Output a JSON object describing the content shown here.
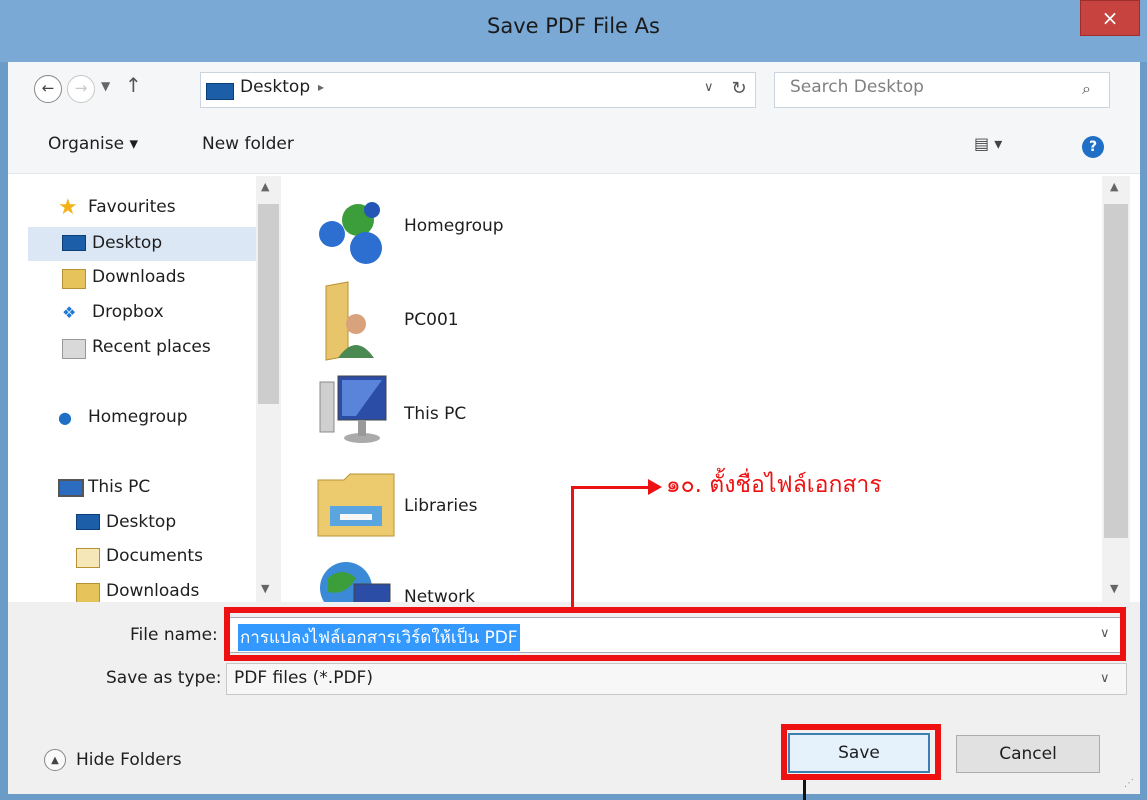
{
  "window": {
    "title": "Save PDF File As",
    "close_glyph": "×"
  },
  "address": {
    "path": "Desktop",
    "separator": "▸",
    "search_placeholder": "Search Desktop"
  },
  "toolbar": {
    "organise": "Organise ▾",
    "new_folder": "New folder",
    "view_glyph": "▤ ▾",
    "help_glyph": "?"
  },
  "nav": {
    "items": [
      {
        "label": "Favourites",
        "icon": "star-icon"
      },
      {
        "label": "Desktop",
        "icon": "desktop-icon",
        "selected": true
      },
      {
        "label": "Downloads",
        "icon": "downloads-icon"
      },
      {
        "label": "Dropbox",
        "icon": "dropbox-icon"
      },
      {
        "label": "Recent places",
        "icon": "recent-places-icon"
      },
      {
        "label": "Homegroup",
        "icon": "homegroup-icon"
      },
      {
        "label": "This PC",
        "icon": "this-pc-icon"
      },
      {
        "label": "Desktop",
        "icon": "desktop-folder-icon"
      },
      {
        "label": "Documents",
        "icon": "documents-icon"
      },
      {
        "label": "Downloads",
        "icon": "downloads-icon"
      }
    ]
  },
  "files": [
    {
      "label": "Homegroup",
      "icon": "homegroup-icon"
    },
    {
      "label": "PC001",
      "icon": "user-folder-icon"
    },
    {
      "label": "This PC",
      "icon": "computer-icon"
    },
    {
      "label": "Libraries",
      "icon": "libraries-icon"
    },
    {
      "label": "Network",
      "icon": "network-icon"
    }
  ],
  "form": {
    "file_name_label": "File name:",
    "file_name_value": "การแปลงไฟล์เอกสารเวิร์ดให้เป็น PDF",
    "save_as_type_label": "Save as type:",
    "save_as_type_value": "PDF files (*.PDF)"
  },
  "footer": {
    "hide_folders": "Hide Folders",
    "save": "Save",
    "cancel": "Cancel"
  },
  "annotation": {
    "step_text": "๑๐. ตั้งชื่อไฟล์เอกสาร",
    "color": "#ee1111"
  }
}
